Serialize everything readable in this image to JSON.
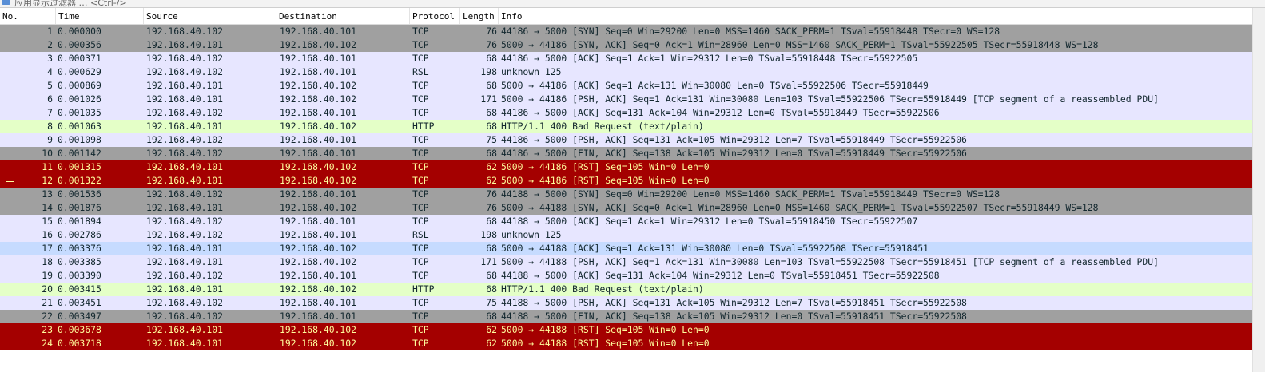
{
  "window": {
    "title_fragment": "应用显示过滤器 … <Ctrl-/>"
  },
  "columns": {
    "no": "No.",
    "time": "Time",
    "source": "Source",
    "destination": "Destination",
    "protocol": "Protocol",
    "length": "Length",
    "info": "Info"
  },
  "colors": {
    "tcp_bg": "#e7e6ff",
    "syn_fin_bg": "#a0a0a0",
    "http_bg": "#e4ffc7",
    "rst_bg": "#a40000",
    "rst_fg": "#fffc9c",
    "selected_bg": "#c6dbff",
    "normal_fg": "#12272e"
  },
  "packets": [
    {
      "no": "1",
      "time": "0.000000",
      "src": "192.168.40.102",
      "dst": "192.168.40.101",
      "proto": "TCP",
      "len": "76",
      "info": "44186 → 5000 [SYN] Seq=0 Win=29200 Len=0 MSS=1460 SACK_PERM=1 TSval=55918448 TSecr=0 WS=128",
      "style": "gray"
    },
    {
      "no": "2",
      "time": "0.000356",
      "src": "192.168.40.101",
      "dst": "192.168.40.102",
      "proto": "TCP",
      "len": "76",
      "info": "5000 → 44186 [SYN, ACK] Seq=0 Ack=1 Win=28960 Len=0 MSS=1460 SACK_PERM=1 TSval=55922505 TSecr=55918448 WS=128",
      "style": "gray"
    },
    {
      "no": "3",
      "time": "0.000371",
      "src": "192.168.40.102",
      "dst": "192.168.40.101",
      "proto": "TCP",
      "len": "68",
      "info": "44186 → 5000 [ACK] Seq=1 Ack=1 Win=29312 Len=0 TSval=55918448 TSecr=55922505",
      "style": "tcp"
    },
    {
      "no": "4",
      "time": "0.000629",
      "src": "192.168.40.102",
      "dst": "192.168.40.101",
      "proto": "RSL",
      "len": "198",
      "info": "unknown 125",
      "style": "tcp"
    },
    {
      "no": "5",
      "time": "0.000869",
      "src": "192.168.40.101",
      "dst": "192.168.40.102",
      "proto": "TCP",
      "len": "68",
      "info": "5000 → 44186 [ACK] Seq=1 Ack=131 Win=30080 Len=0 TSval=55922506 TSecr=55918449",
      "style": "tcp"
    },
    {
      "no": "6",
      "time": "0.001026",
      "src": "192.168.40.101",
      "dst": "192.168.40.102",
      "proto": "TCP",
      "len": "171",
      "info": "5000 → 44186 [PSH, ACK] Seq=1 Ack=131 Win=30080 Len=103 TSval=55922506 TSecr=55918449 [TCP segment of a reassembled PDU]",
      "style": "tcp"
    },
    {
      "no": "7",
      "time": "0.001035",
      "src": "192.168.40.102",
      "dst": "192.168.40.101",
      "proto": "TCP",
      "len": "68",
      "info": "44186 → 5000 [ACK] Seq=131 Ack=104 Win=29312 Len=0 TSval=55918449 TSecr=55922506",
      "style": "tcp"
    },
    {
      "no": "8",
      "time": "0.001063",
      "src": "192.168.40.101",
      "dst": "192.168.40.102",
      "proto": "HTTP",
      "len": "68",
      "info": "HTTP/1.1 400 Bad Request  (text/plain)",
      "style": "http"
    },
    {
      "no": "9",
      "time": "0.001098",
      "src": "192.168.40.102",
      "dst": "192.168.40.101",
      "proto": "TCP",
      "len": "75",
      "info": "44186 → 5000 [PSH, ACK] Seq=131 Ack=105 Win=29312 Len=7 TSval=55918449 TSecr=55922506",
      "style": "tcp"
    },
    {
      "no": "10",
      "time": "0.001142",
      "src": "192.168.40.102",
      "dst": "192.168.40.101",
      "proto": "TCP",
      "len": "68",
      "info": "44186 → 5000 [FIN, ACK] Seq=138 Ack=105 Win=29312 Len=0 TSval=55918449 TSecr=55922506",
      "style": "gray"
    },
    {
      "no": "11",
      "time": "0.001315",
      "src": "192.168.40.101",
      "dst": "192.168.40.102",
      "proto": "TCP",
      "len": "62",
      "info": "5000 → 44186 [RST] Seq=105 Win=0 Len=0",
      "style": "rst"
    },
    {
      "no": "12",
      "time": "0.001322",
      "src": "192.168.40.101",
      "dst": "192.168.40.102",
      "proto": "TCP",
      "len": "62",
      "info": "5000 → 44186 [RST] Seq=105 Win=0 Len=0",
      "style": "rst"
    },
    {
      "no": "13",
      "time": "0.001536",
      "src": "192.168.40.102",
      "dst": "192.168.40.101",
      "proto": "TCP",
      "len": "76",
      "info": "44188 → 5000 [SYN] Seq=0 Win=29200 Len=0 MSS=1460 SACK_PERM=1 TSval=55918449 TSecr=0 WS=128",
      "style": "gray"
    },
    {
      "no": "14",
      "time": "0.001876",
      "src": "192.168.40.101",
      "dst": "192.168.40.102",
      "proto": "TCP",
      "len": "76",
      "info": "5000 → 44188 [SYN, ACK] Seq=0 Ack=1 Win=28960 Len=0 MSS=1460 SACK_PERM=1 TSval=55922507 TSecr=55918449 WS=128",
      "style": "gray"
    },
    {
      "no": "15",
      "time": "0.001894",
      "src": "192.168.40.102",
      "dst": "192.168.40.101",
      "proto": "TCP",
      "len": "68",
      "info": "44188 → 5000 [ACK] Seq=1 Ack=1 Win=29312 Len=0 TSval=55918450 TSecr=55922507",
      "style": "tcp"
    },
    {
      "no": "16",
      "time": "0.002786",
      "src": "192.168.40.102",
      "dst": "192.168.40.101",
      "proto": "RSL",
      "len": "198",
      "info": "unknown 125",
      "style": "tcp"
    },
    {
      "no": "17",
      "time": "0.003376",
      "src": "192.168.40.101",
      "dst": "192.168.40.102",
      "proto": "TCP",
      "len": "68",
      "info": "5000 → 44188 [ACK] Seq=1 Ack=131 Win=30080 Len=0 TSval=55922508 TSecr=55918451",
      "style": "selected"
    },
    {
      "no": "18",
      "time": "0.003385",
      "src": "192.168.40.101",
      "dst": "192.168.40.102",
      "proto": "TCP",
      "len": "171",
      "info": "5000 → 44188 [PSH, ACK] Seq=1 Ack=131 Win=30080 Len=103 TSval=55922508 TSecr=55918451 [TCP segment of a reassembled PDU]",
      "style": "tcp"
    },
    {
      "no": "19",
      "time": "0.003390",
      "src": "192.168.40.102",
      "dst": "192.168.40.101",
      "proto": "TCP",
      "len": "68",
      "info": "44188 → 5000 [ACK] Seq=131 Ack=104 Win=29312 Len=0 TSval=55918451 TSecr=55922508",
      "style": "tcp"
    },
    {
      "no": "20",
      "time": "0.003415",
      "src": "192.168.40.101",
      "dst": "192.168.40.102",
      "proto": "HTTP",
      "len": "68",
      "info": "HTTP/1.1 400 Bad Request  (text/plain)",
      "style": "http"
    },
    {
      "no": "21",
      "time": "0.003451",
      "src": "192.168.40.102",
      "dst": "192.168.40.101",
      "proto": "TCP",
      "len": "75",
      "info": "44188 → 5000 [PSH, ACK] Seq=131 Ack=105 Win=29312 Len=7 TSval=55918451 TSecr=55922508",
      "style": "tcp"
    },
    {
      "no": "22",
      "time": "0.003497",
      "src": "192.168.40.102",
      "dst": "192.168.40.101",
      "proto": "TCP",
      "len": "68",
      "info": "44188 → 5000 [FIN, ACK] Seq=138 Ack=105 Win=29312 Len=0 TSval=55918451 TSecr=55922508",
      "style": "gray"
    },
    {
      "no": "23",
      "time": "0.003678",
      "src": "192.168.40.101",
      "dst": "192.168.40.102",
      "proto": "TCP",
      "len": "62",
      "info": "5000 → 44188 [RST] Seq=105 Win=0 Len=0",
      "style": "rst"
    },
    {
      "no": "24",
      "time": "0.003718",
      "src": "192.168.40.101",
      "dst": "192.168.40.102",
      "proto": "TCP",
      "len": "62",
      "info": "5000 → 44188 [RST] Seq=105 Win=0 Len=0",
      "style": "rst"
    }
  ]
}
